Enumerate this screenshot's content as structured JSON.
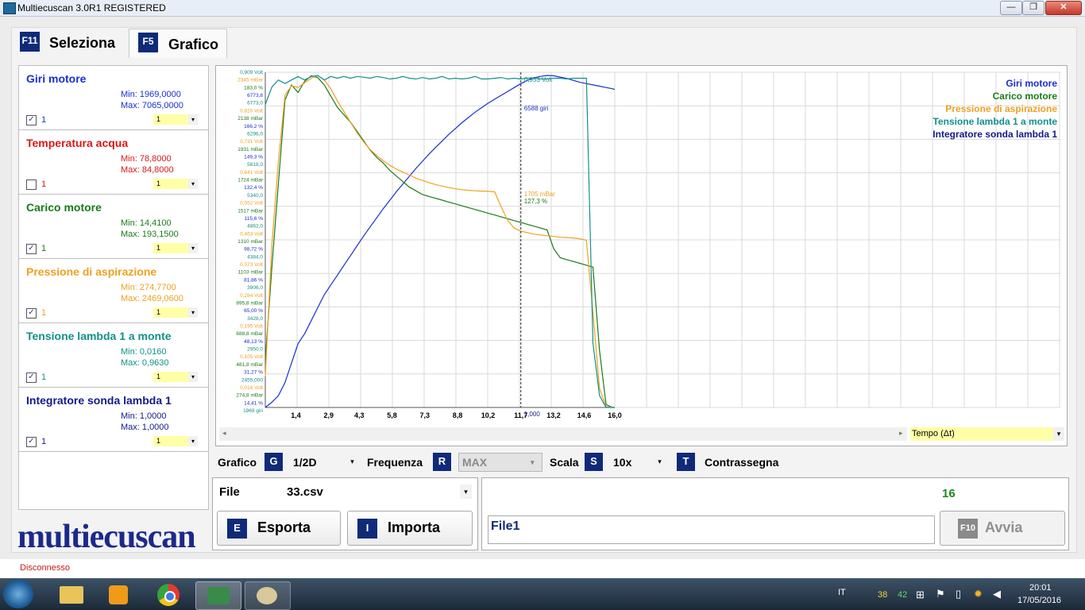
{
  "window": {
    "title": "Multiecuscan 3.0R1 REGISTERED",
    "minimize": "—",
    "restore": "❐",
    "close": "✕"
  },
  "tabs": [
    {
      "key": "F11",
      "label": "Seleziona"
    },
    {
      "key": "F5",
      "label": "Grafico"
    }
  ],
  "params": [
    {
      "name": "Giri motore",
      "color": "#1a2ed0",
      "min": "Min: 1969,0000",
      "max": "Max: 7065,0000",
      "checked": true,
      "checkval": "1",
      "combo": "1"
    },
    {
      "name": "Temperatura acqua",
      "color": "#d81818",
      "min": "Min: 78,8000",
      "max": "Max: 84,8000",
      "checked": false,
      "checkval": "1",
      "combo": "1"
    },
    {
      "name": "Carico motore",
      "color": "#1a7a1a",
      "min": "Min: 14,4100",
      "max": "Max: 193,1500",
      "checked": true,
      "checkval": "1",
      "combo": "1"
    },
    {
      "name": "Pressione di aspirazione",
      "color": "#f0a020",
      "min": "Min: 274,7700",
      "max": "Max: 2469,0600",
      "checked": true,
      "checkval": "1",
      "combo": "1"
    },
    {
      "name": "Tensione lambda 1 a monte",
      "color": "#12908a",
      "min": "Min: 0,0160",
      "max": "Max: 0,9630",
      "checked": true,
      "checkval": "1",
      "combo": "1"
    },
    {
      "name": "Integratore sonda lambda 1",
      "color": "#141a8a",
      "min": "Min: 1,0000",
      "max": "Max: 1,0000",
      "checked": true,
      "checkval": "1",
      "combo": "1"
    }
  ],
  "logo": "multiecuscan",
  "chart_data": {
    "type": "line",
    "x": [
      0.0,
      0.3,
      0.6,
      0.9,
      1.2,
      1.5,
      1.8,
      2.1,
      2.4,
      2.7,
      3.0,
      3.3,
      3.6,
      3.9,
      4.2,
      4.5,
      4.8,
      5.1,
      5.4,
      5.7,
      6.0,
      6.3,
      6.6,
      6.9,
      7.2,
      7.5,
      7.8,
      8.1,
      8.4,
      8.7,
      9.0,
      9.3,
      9.6,
      9.9,
      10.2,
      10.5,
      10.8,
      11.1,
      11.4,
      11.7,
      12.0,
      12.3,
      12.6,
      12.9,
      13.2,
      13.5,
      13.8,
      14.1,
      14.4,
      14.7,
      15.0,
      15.3,
      15.6,
      15.9,
      16.0
    ],
    "x_ticks": [
      "1,4",
      "2,9",
      "4,3",
      "5,8",
      "7,3",
      "8,8",
      "10,2",
      "11,7",
      "13,2",
      "14,6",
      "16,0"
    ],
    "x_tick_values": [
      1.4,
      2.9,
      4.3,
      5.8,
      7.3,
      8.8,
      10.2,
      11.7,
      13.2,
      14.6,
      16.0
    ],
    "xlim": [
      0.0,
      16.0
    ],
    "series": [
      {
        "name": "Giri motore",
        "color": "#1a2ed0",
        "unit": "giri",
        "ylim": [
          1969,
          7065
        ],
        "values": [
          1969,
          2050,
          2150,
          2350,
          2650,
          2950,
          3100,
          3300,
          3500,
          3700,
          3850,
          4000,
          4150,
          4300,
          4450,
          4600,
          4740,
          4880,
          5020,
          5150,
          5280,
          5400,
          5520,
          5640,
          5750,
          5860,
          5960,
          6060,
          6160,
          6250,
          6340,
          6420,
          6500,
          6570,
          6640,
          6700,
          6760,
          6820,
          6880,
          6940,
          6990,
          7030,
          7050,
          7065,
          7060,
          7040,
          7020,
          6990,
          6960,
          6940,
          6920,
          6900,
          6880,
          6860,
          6850
        ]
      },
      {
        "name": "Carico motore",
        "color": "#1a7a1a",
        "unit": "%",
        "ylim": [
          14.41,
          193.15
        ],
        "values": [
          40,
          90,
          135,
          180,
          188,
          184,
          190,
          193,
          192,
          188,
          182,
          176,
          172,
          168,
          163,
          158,
          153,
          149,
          146,
          142,
          139,
          136,
          133,
          131,
          129,
          128,
          127,
          126,
          125,
          124,
          123,
          122,
          121,
          120,
          119,
          118,
          117,
          116,
          115,
          114,
          113,
          112,
          111,
          110,
          100,
          95,
          94,
          93,
          92,
          91,
          90,
          45,
          16,
          14.41,
          14.41
        ]
      },
      {
        "name": "Pressione di aspirazione",
        "color": "#f0a020",
        "unit": "mBar",
        "ylim": [
          274.8,
          2469.06
        ],
        "values": [
          480,
          1350,
          1900,
          2340,
          2400,
          2390,
          2420,
          2450,
          2469,
          2440,
          2380,
          2300,
          2230,
          2160,
          2090,
          2030,
          1980,
          1940,
          1905,
          1875,
          1850,
          1830,
          1810,
          1790,
          1775,
          1760,
          1748,
          1738,
          1728,
          1720,
          1714,
          1710,
          1707,
          1705,
          1703,
          1700,
          1600,
          1510,
          1460,
          1440,
          1430,
          1420,
          1415,
          1410,
          1405,
          1400,
          1398,
          1395,
          1390,
          1380,
          900,
          400,
          280,
          274.8,
          274.8
        ]
      },
      {
        "name": "Tensione lambda 1 a monte",
        "color": "#12908a",
        "unit": "Volt",
        "ylim": [
          0.016,
          0.963
        ],
        "values": [
          0.88,
          0.93,
          0.95,
          0.94,
          0.95,
          0.96,
          0.95,
          0.96,
          0.963,
          0.95,
          0.96,
          0.955,
          0.96,
          0.955,
          0.96,
          0.958,
          0.955,
          0.96,
          0.957,
          0.953,
          0.955,
          0.96,
          0.955,
          0.953,
          0.957,
          0.953,
          0.955,
          0.96,
          0.953,
          0.955,
          0.953,
          0.955,
          0.96,
          0.953,
          0.953,
          0.955,
          0.957,
          0.953,
          0.955,
          0.953,
          0.955,
          0.955,
          0.953,
          0.953,
          0.955,
          0.955,
          0.953,
          0.955,
          0.955,
          0.955,
          0.2,
          0.05,
          0.016,
          0.016,
          0.016
        ]
      },
      {
        "name": "Integratore sonda lambda 1",
        "color": "#141a8a",
        "unit": "",
        "ylim": [
          1,
          1
        ],
        "values": []
      }
    ],
    "cursor": {
      "x": 11.7,
      "labels": [
        "0,953 Volt",
        "6588 giri",
        "1705 mBar",
        "127,3 %",
        "1,000"
      ]
    },
    "y_axis_labels": [
      "0,909 Volt",
      "2345 mBar",
      "183,0 %",
      "6773,8",
      "6773,0",
      "0,820 Volt",
      "2138 mBar",
      "166,2 %",
      "6296,0",
      "0,731 Volt",
      "1931 mBar",
      "149,3 %",
      "5818,0",
      "0,641 Volt",
      "1724 mBar",
      "132,4 %",
      "5340,0",
      "0,552 Volt",
      "1517 mBar",
      "115,6 %",
      "4862,0",
      "0,463 Volt",
      "1310 mBar",
      "98,72 %",
      "4384,0",
      "0,373 Volt",
      "1103 mBar",
      "81,86 %",
      "3906,0",
      "0,284 Volt",
      "895,8 mBar",
      "65,00 %",
      "3428,0",
      "0,195 Volt",
      "688,8 mBar",
      "48,13 %",
      "2950,0",
      "0,105 Volt",
      "481,8 mBar",
      "31,27 %",
      "2455,000",
      "0,016 Volt",
      "274,8 mBar",
      "14,41 %",
      "1969 giri"
    ],
    "grid": true,
    "legend_placement": "top-right"
  },
  "tempo_combo": "Tempo (Δt)",
  "controls": {
    "grafico_label": "Grafico",
    "grafico_key": "G",
    "grafico_value": "1/2D",
    "frequenza_label": "Frequenza",
    "frequenza_key": "R",
    "frequenza_value": "MAX",
    "scala_label": "Scala",
    "scala_key": "S",
    "scala_value": "10x",
    "contrassegna_key": "T",
    "contrassegna_label": "Contrassegna"
  },
  "file": {
    "label": "File",
    "value": "33.csv",
    "esporta_key": "E",
    "esporta": "Esporta",
    "importa_key": "I",
    "importa": "Importa"
  },
  "right": {
    "counter": "16",
    "name_value": "File1",
    "avvia_key": "F10",
    "avvia": "Avvia"
  },
  "status": "Disconnesso",
  "taskbar": {
    "lang": "IT",
    "n1": "38",
    "n2": "42",
    "time": "20:01",
    "date": "17/05/2016"
  }
}
